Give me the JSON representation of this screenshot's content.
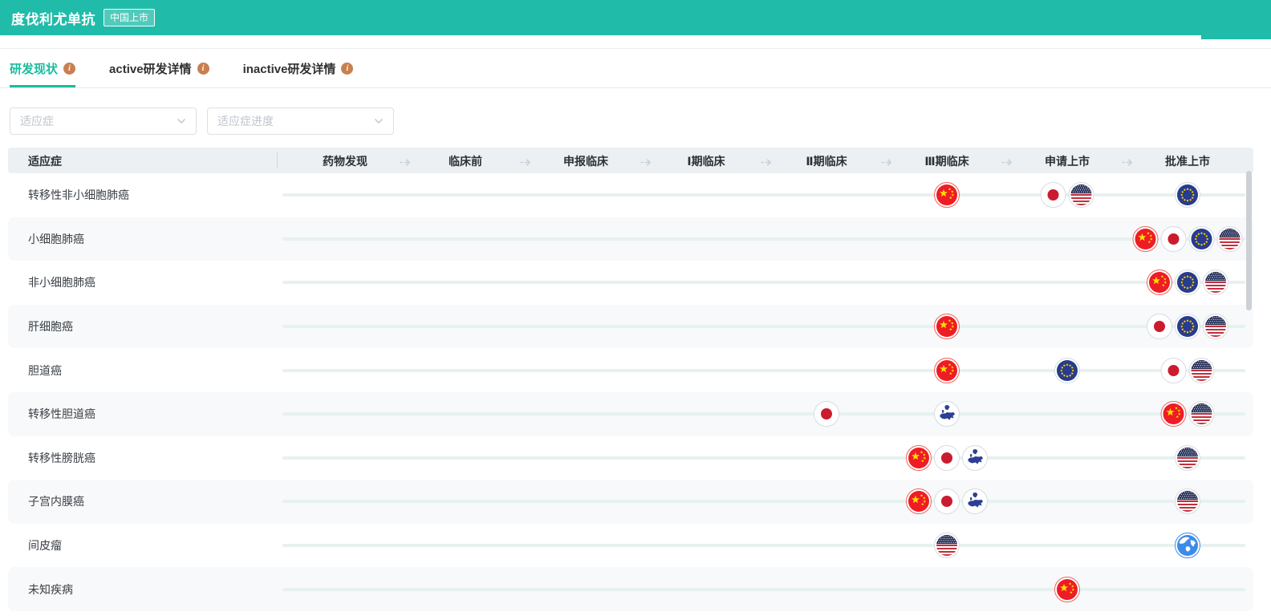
{
  "header": {
    "title": "度伐利尤单抗",
    "badge": "中国上市"
  },
  "tabs": [
    {
      "label": "研发现状",
      "active": true
    },
    {
      "label": "active研发详情",
      "active": false
    },
    {
      "label": "inactive研发详情",
      "active": false
    }
  ],
  "filters": [
    {
      "placeholder": "适应症"
    },
    {
      "placeholder": "适应症进度"
    }
  ],
  "table": {
    "indication_header": "适应症",
    "stage_headers": [
      "药物发现",
      "临床前",
      "申报临床",
      "Ⅰ期临床",
      "Ⅱ期临床",
      "Ⅲ期临床",
      "申请上市",
      "批准上市"
    ],
    "rows": [
      {
        "indication": "转移性非小细胞肺癌",
        "stages": {
          "5": [
            "china"
          ],
          "6": [
            "japan",
            "usa"
          ],
          "7": [
            "eu"
          ]
        }
      },
      {
        "indication": "小细胞肺癌",
        "stages": {
          "7": [
            "china",
            "japan",
            "eu",
            "usa"
          ]
        }
      },
      {
        "indication": "非小细胞肺癌",
        "stages": {
          "7": [
            "china",
            "eu",
            "usa"
          ]
        }
      },
      {
        "indication": "肝细胞癌",
        "stages": {
          "5": [
            "china"
          ],
          "7": [
            "japan",
            "eu",
            "usa"
          ]
        }
      },
      {
        "indication": "胆道癌",
        "stages": {
          "5": [
            "china"
          ],
          "6": [
            "eu"
          ],
          "7": [
            "japan",
            "usa"
          ]
        }
      },
      {
        "indication": "转移性胆道癌",
        "stages": {
          "4": [
            "japan"
          ],
          "5": [
            "europe-map"
          ],
          "7": [
            "china",
            "usa"
          ]
        }
      },
      {
        "indication": "转移性膀胱癌",
        "stages": {
          "5": [
            "china",
            "japan",
            "europe-map"
          ],
          "7": [
            "usa"
          ]
        }
      },
      {
        "indication": "子宫内膜癌",
        "stages": {
          "5": [
            "china",
            "japan",
            "europe-map"
          ],
          "7": [
            "usa"
          ]
        }
      },
      {
        "indication": "间皮瘤",
        "stages": {
          "5": [
            "usa"
          ],
          "7": [
            "globe"
          ]
        }
      },
      {
        "indication": "未知疾病",
        "stages": {
          "6": [
            "china"
          ]
        }
      }
    ]
  },
  "colors": {
    "accent_teal": "#20BCA9",
    "tab_active": "#18BC9C",
    "info_icon": "#C9804E",
    "table_header_bg": "#ECF0F3",
    "timeline": "#E7F1F0",
    "ring_active_red": "#F2625B",
    "ring_default_gray": "#D6DCE2",
    "ring_global_blue": "#3D8BE8"
  }
}
